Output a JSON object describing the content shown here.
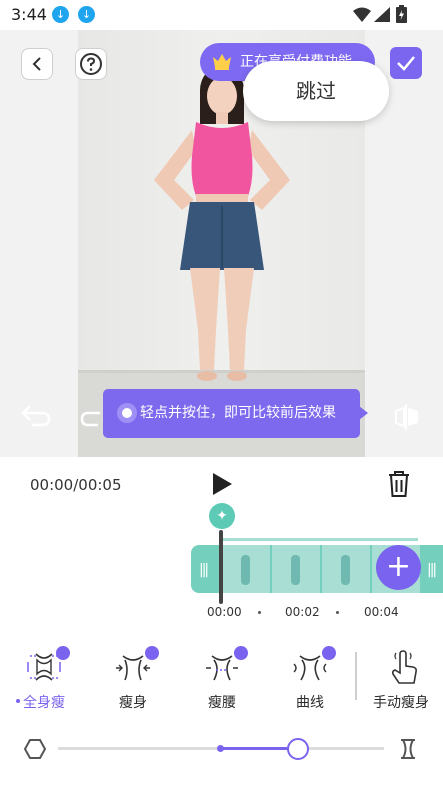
{
  "status_bar": {
    "time": "3:44",
    "icons": [
      "download-icon",
      "download-icon",
      "wifi-icon",
      "signal-icon",
      "battery-charging-icon"
    ]
  },
  "editor": {
    "premium_banner": "正在享受付费功能",
    "skip_label": "跳过",
    "tooltip": "轻点并按住，即可比较前后效果"
  },
  "timeline": {
    "timecode": "00:00/00:05",
    "ticks": [
      "00:00",
      "00:02",
      "00:04"
    ]
  },
  "tools": {
    "items": [
      {
        "label": "全身瘦",
        "active": true,
        "premium": true,
        "icon": "full-body-slim-icon"
      },
      {
        "label": "瘦身",
        "active": false,
        "premium": true,
        "icon": "slim-body-icon"
      },
      {
        "label": "瘦腰",
        "active": false,
        "premium": true,
        "icon": "slim-waist-icon"
      },
      {
        "label": "曲线",
        "active": false,
        "premium": true,
        "icon": "curve-icon"
      },
      {
        "label": "手动瘦身",
        "active": false,
        "premium": false,
        "icon": "hand-pointer-icon"
      }
    ]
  },
  "slider": {
    "value": 0.56
  },
  "colors": {
    "accent": "#7a64ef",
    "teal": "#75cfbd",
    "download": "#1ea5ee"
  }
}
